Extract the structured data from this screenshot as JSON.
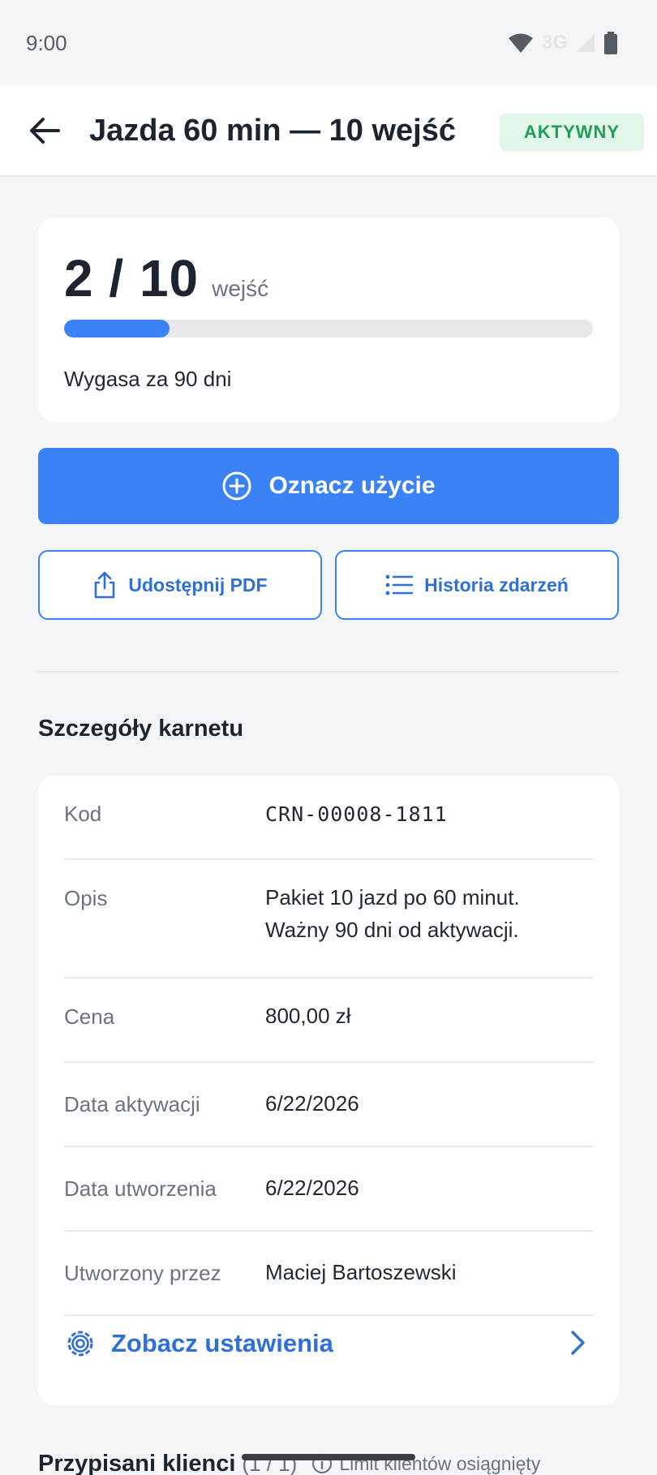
{
  "status_bar": {
    "time": "9:00",
    "network": "3G"
  },
  "header": {
    "title": "Jazda 60 min — 10 wejść",
    "badge": "AKTYWNY",
    "badge_color": "#1f9e57"
  },
  "usage": {
    "used": 2,
    "total": 10,
    "count_text": "2 / 10",
    "unit": "wejść",
    "progress_fraction": 0.2,
    "expiry_text": "Wygasa za 90 dni"
  },
  "actions": {
    "primary_label": "Oznacz użycie",
    "share_label": "Udostępnij PDF",
    "history_label": "Historia zdarzeń"
  },
  "details": {
    "section_title": "Szczegóły karnetu",
    "rows": [
      {
        "label": "Kod",
        "value": "CRN-00008-1811"
      },
      {
        "label": "Opis",
        "value_line1": "Pakiet 10 jazd po 60 minut.",
        "value_line2": "Ważny 90 dni od aktywacji."
      },
      {
        "label": "Cena",
        "value": "800,00 zł"
      },
      {
        "label": "Data aktywacji",
        "value": "6/22/2026"
      },
      {
        "label": "Data utworzenia",
        "value": "6/22/2026"
      },
      {
        "label": "Utworzony przez",
        "value": "Maciej Bartoszewski"
      }
    ],
    "settings_link": "Zobacz ustawienia"
  },
  "clients": {
    "title": "Przypisani klienci",
    "count": "(1 / 1)",
    "limit_text": "Limit klientów osiągnięty"
  },
  "colors": {
    "accent": "#3b82f6",
    "background": "#f3f5f7"
  }
}
